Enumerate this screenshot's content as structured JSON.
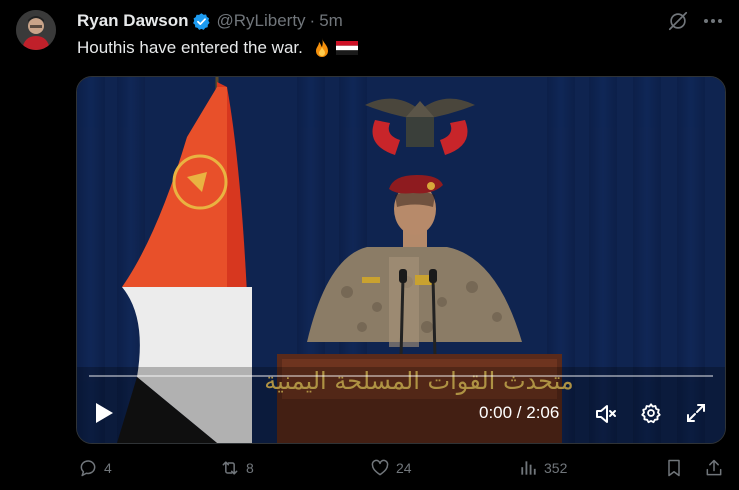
{
  "tweet": {
    "author_name": "Ryan Dawson",
    "handle": "@RyLiberty",
    "separator": "·",
    "time": "5m",
    "text": "Houthis have entered the war.",
    "emoji_icons": [
      "fire-emoji-icon",
      "yemen-flag-emoji-icon"
    ]
  },
  "video": {
    "timecode": "0:00 / 2:06",
    "progress": 0,
    "podium_text": "متحدث القوات المسلحة اليمنية"
  },
  "actions": {
    "replies": "4",
    "reposts": "8",
    "likes": "24",
    "views": "352"
  },
  "colors": {
    "background": "#000000",
    "text": "#e7e9ea",
    "muted": "#71767b",
    "verified": "#1d9bf0"
  }
}
